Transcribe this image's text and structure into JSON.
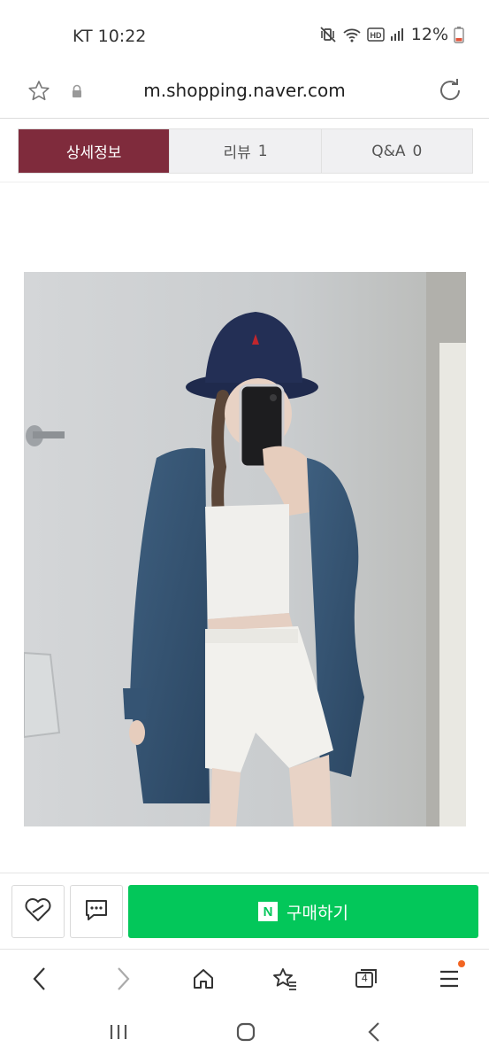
{
  "status_bar": {
    "carrier_time": "KT 10:22",
    "battery_percent": "12%",
    "icons": [
      "mute-vibrate-icon",
      "wifi-icon",
      "hd-icon",
      "signal-icon",
      "battery-icon"
    ],
    "hd_label": "HD"
  },
  "url_bar": {
    "url": "m.shopping.naver.com",
    "icons": [
      "star-icon",
      "lock-icon",
      "reload-icon"
    ]
  },
  "tabs": [
    {
      "label": "상세정보",
      "count": "",
      "active": true
    },
    {
      "label": "리뷰",
      "count": "1",
      "active": false
    },
    {
      "label": "Q&A",
      "count": "0",
      "active": false
    }
  ],
  "product_image": {
    "icon": "product-photo"
  },
  "action_bar": {
    "buy_label": "구매하기",
    "logo_letter": "N",
    "icons": [
      "heart-icon",
      "talk-icon"
    ]
  },
  "browser_nav": {
    "tab_count": "4",
    "icons": [
      "back-icon",
      "forward-icon",
      "home-icon",
      "bookmarks-icon",
      "tabs-icon",
      "menu-icon"
    ]
  },
  "system_nav": {
    "icons": [
      "recents-icon",
      "home-circle-icon",
      "back-chevron-icon"
    ]
  },
  "colors": {
    "tab_active": "#7f2b3c",
    "buy_green": "#03c75a",
    "menu_badge": "#f26522"
  }
}
